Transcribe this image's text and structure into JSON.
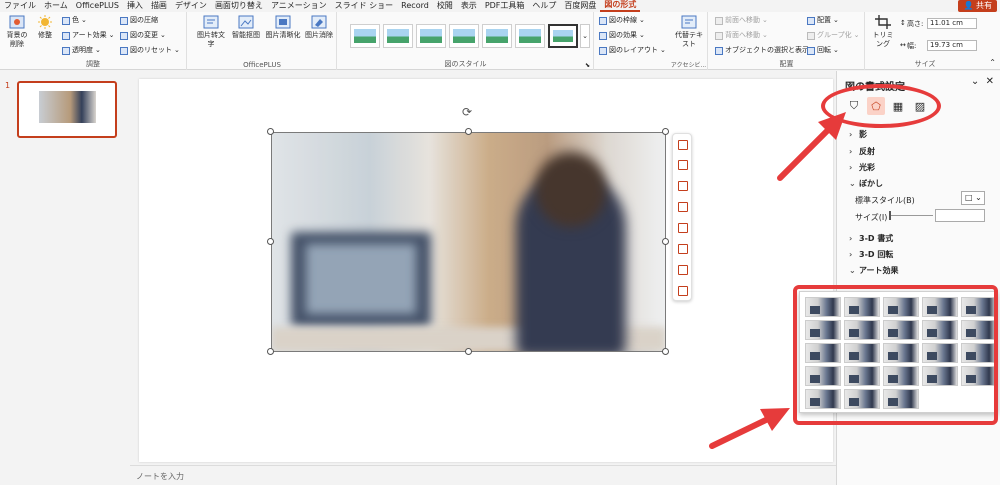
{
  "menu": {
    "tabs": [
      "ファイル",
      "ホーム",
      "OfficePLUS",
      "挿入",
      "描画",
      "デザイン",
      "画面切り替え",
      "アニメーション",
      "スライド ショー",
      "Record",
      "校閲",
      "表示",
      "PDF工具箱",
      "ヘルプ",
      "百度网盘",
      "図の形式"
    ],
    "active_tab": "図の形式",
    "share_label": "共有"
  },
  "ribbon": {
    "adjust": {
      "remove_bg": "背景の削除",
      "correct": "修整",
      "color": "色",
      "artistic": "アート効果",
      "transparency": "透明度",
      "compress": "図の圧縮",
      "change": "図の変更",
      "reset": "図のリセット",
      "label": "調整"
    },
    "officeplus": {
      "buttons": [
        "图片转文字",
        "智能抠图",
        "图片清晰化",
        "图片消除"
      ],
      "label": "OfficePLUS"
    },
    "styles": {
      "label": "図のスタイル"
    },
    "pic_options": {
      "border": "図の枠線",
      "effects": "図の効果",
      "layout": "図のレイアウト"
    },
    "accessibility": {
      "alt_text": "代替テキスト",
      "label": "アクセシビ..."
    },
    "arrange": {
      "bring_forward": "前面へ移動",
      "send_backward": "背面へ移動",
      "selection_pane": "オブジェクトの選択と表示",
      "align": "配置",
      "group": "グループ化",
      "rotate": "回転",
      "label": "配置"
    },
    "size": {
      "crop": "トリミング",
      "height_label": "高さ:",
      "height_value": "11.01 cm",
      "width_label": "幅:",
      "width_value": "19.73 cm",
      "label": "サイズ"
    }
  },
  "slides": {
    "number": "1"
  },
  "notes_placeholder": "ノートを入力",
  "pane": {
    "title": "図の書式設定",
    "sections": {
      "shadow": "影",
      "reflection": "反射",
      "glow": "光彩",
      "soft_edges": "ぼかし",
      "bevel": "3-D 書式",
      "rotation": "3-D 回転",
      "artistic": "アート効果"
    },
    "preset_label": "標準スタイル(B)",
    "size_label": "サイズ(I)"
  },
  "colors": {
    "accent": "#c43e1c",
    "annotation": "#e63b3b"
  }
}
